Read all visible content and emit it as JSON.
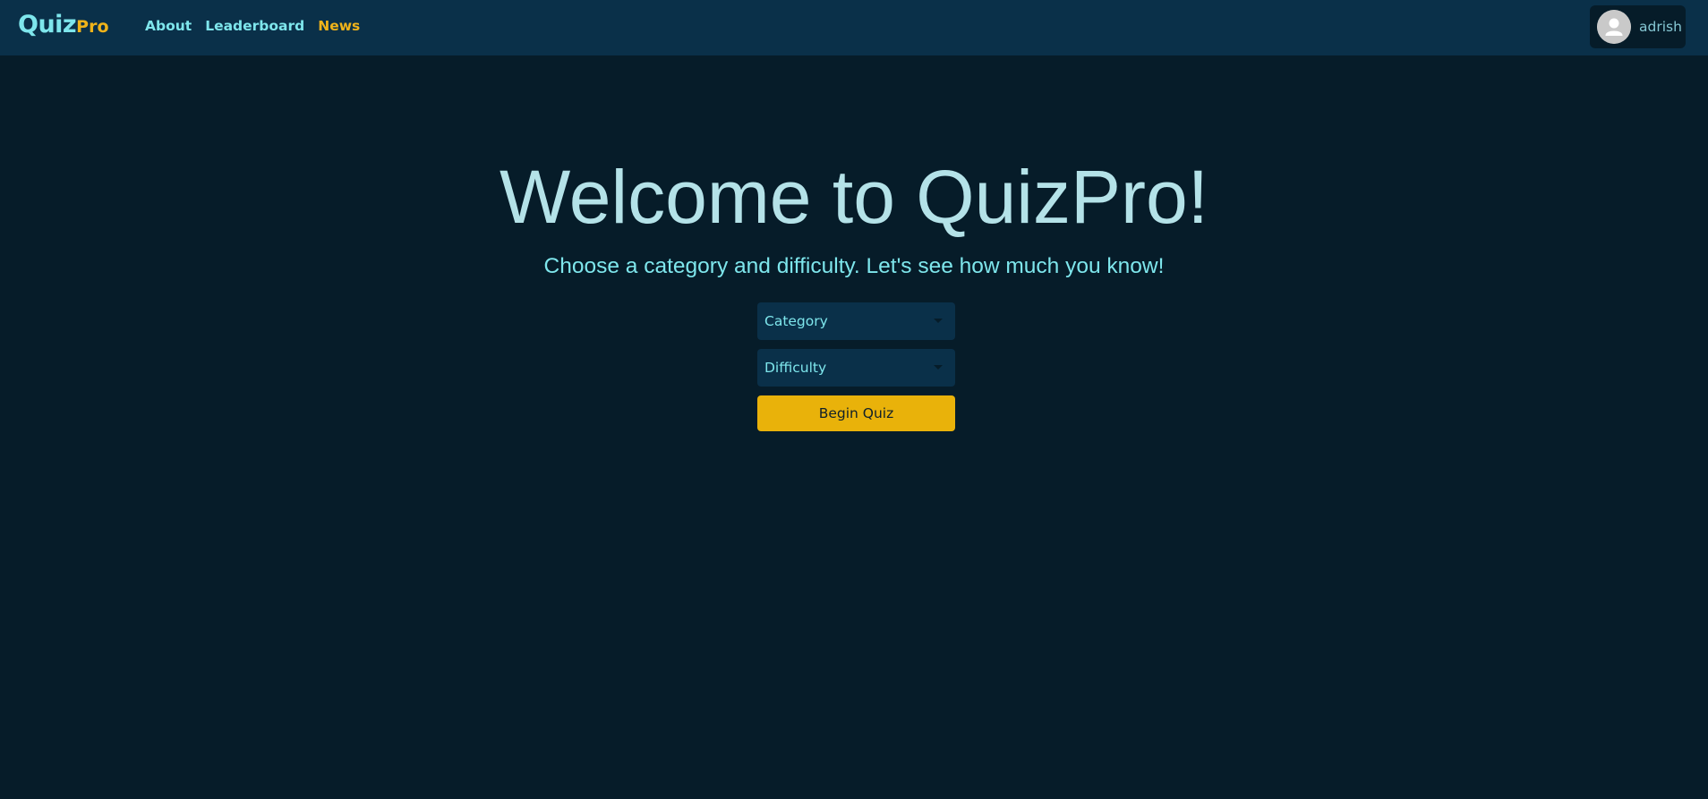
{
  "brand": {
    "part1": "Quiz",
    "part2": "Pro"
  },
  "nav": {
    "items": [
      {
        "label": "About",
        "active": false
      },
      {
        "label": "Leaderboard",
        "active": false
      },
      {
        "label": "News",
        "active": true
      }
    ]
  },
  "user": {
    "name": "adrish",
    "avatar_icon": "user-avatar-icon"
  },
  "hero": {
    "title": "Welcome to QuizPro!",
    "subtitle": "Choose a category and difficulty. Let's see how much you know!"
  },
  "form": {
    "category_placeholder": "Category",
    "difficulty_placeholder": "Difficulty",
    "submit_label": "Begin Quiz"
  },
  "colors": {
    "background": "#061c29",
    "navbar": "#0a3049",
    "accent_cyan": "#7ee6ec",
    "accent_gold": "#f0b31a",
    "button": "#e9b20a"
  }
}
